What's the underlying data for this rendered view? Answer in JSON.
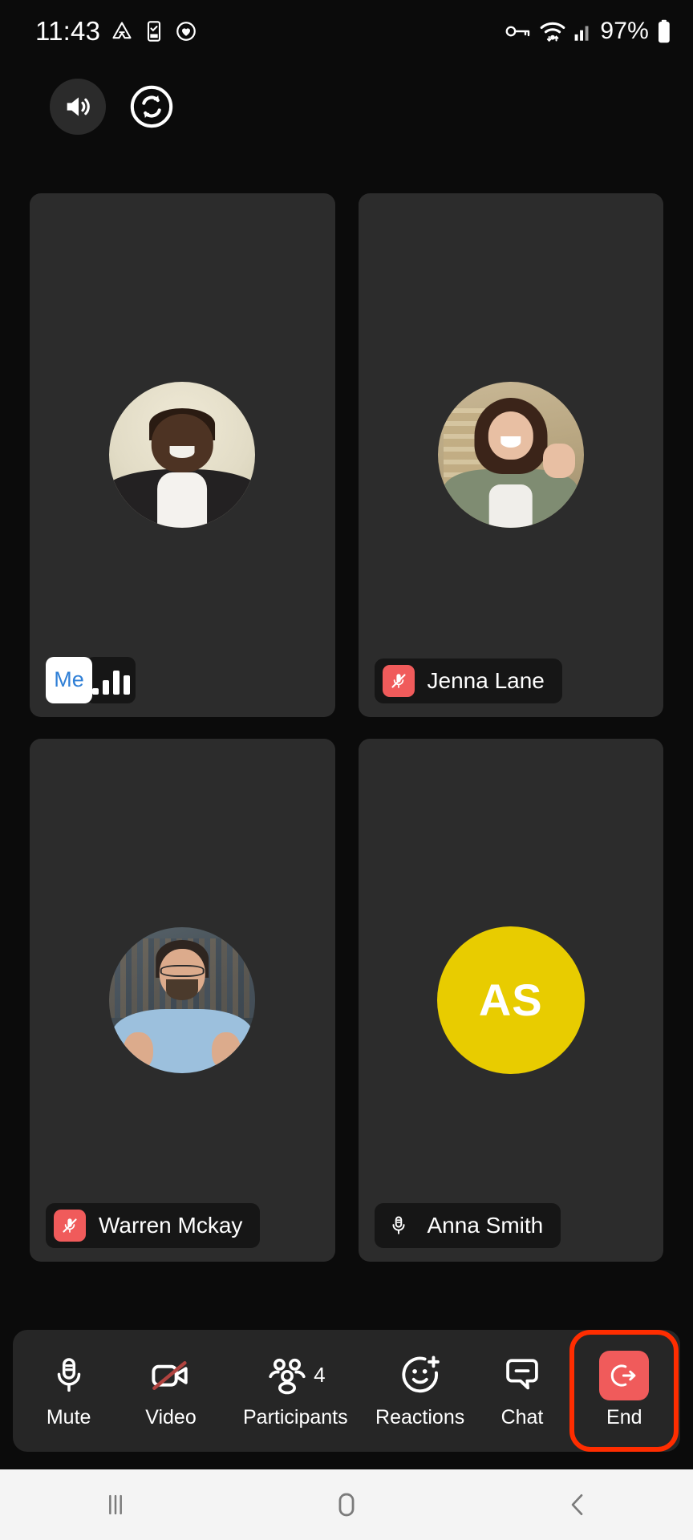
{
  "status_bar": {
    "time": "11:43",
    "battery_percent": "97%",
    "left_icons": [
      "google-drive-icon",
      "phone-checklist-icon",
      "heart-activity-icon"
    ],
    "right_icons": [
      "vpn-key-icon",
      "wifi-icon",
      "cellular-signal-icon",
      "battery-icon"
    ]
  },
  "top_controls": [
    {
      "name": "speaker-button",
      "icon": "speaker-icon"
    },
    {
      "name": "switch-camera-button",
      "icon": "camera-switch-icon"
    }
  ],
  "participants": [
    {
      "id": "me",
      "label": "Me",
      "is_self": true,
      "badge_type": "me-with-signal",
      "signal_bars": [
        14,
        26,
        36,
        30
      ],
      "avatar_type": "photo",
      "avatar_style": "ph-a",
      "mic": "active"
    },
    {
      "id": "jenna",
      "label": "Jenna Lane",
      "is_self": false,
      "badge_type": "name",
      "avatar_type": "photo",
      "avatar_style": "ph-b",
      "mic": "muted"
    },
    {
      "id": "warren",
      "label": "Warren Mckay",
      "is_self": false,
      "badge_type": "name",
      "avatar_type": "photo",
      "avatar_style": "ph-c",
      "mic": "muted"
    },
    {
      "id": "anna",
      "label": "Anna Smith",
      "is_self": false,
      "badge_type": "name",
      "avatar_type": "initials",
      "initials": "AS",
      "avatar_color": "#E8CC00",
      "mic": "unmuted"
    }
  ],
  "toolbar": {
    "mute": {
      "label": "Mute",
      "icon": "microphone-icon",
      "state": "unmuted"
    },
    "video": {
      "label": "Video",
      "icon": "video-off-icon",
      "state": "off"
    },
    "participants": {
      "label": "Participants",
      "icon": "people-icon",
      "count": "4"
    },
    "reactions": {
      "label": "Reactions",
      "icon": "smiley-plus-icon"
    },
    "chat": {
      "label": "Chat",
      "icon": "chat-bubble-icon"
    },
    "end": {
      "label": "End",
      "icon": "leave-call-icon",
      "highlighted": true,
      "highlight_color": "#FF2D00",
      "button_color": "#F05B5B"
    }
  },
  "nav_bar": {
    "recents": "recents-icon",
    "home": "home-icon",
    "back": "back-icon"
  },
  "colors": {
    "page_background": "#0B0B0B",
    "tile_background": "#2C2C2C",
    "chip_background": "#161616",
    "toolbar_background": "#262626",
    "muted_red": "#F05B5B",
    "highlight_red": "#FF2D00",
    "me_text_blue": "#2F7FD6"
  }
}
